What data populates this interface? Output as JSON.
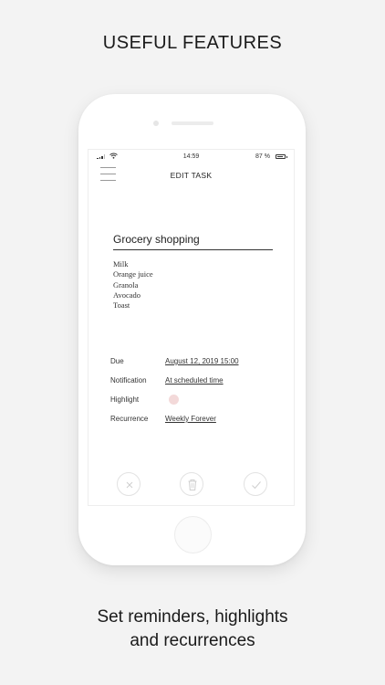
{
  "promo": {
    "headline": "USEFUL FEATURES",
    "caption_line1": "Set reminders, highlights",
    "caption_line2": "and recurrences"
  },
  "status_bar": {
    "time": "14:59",
    "battery": "87 %"
  },
  "nav": {
    "title": "EDIT TASK",
    "menu_icon": "hamburger-menu-icon"
  },
  "task": {
    "title": "Grocery shopping",
    "notes": [
      "Milk",
      "Orange juice",
      "Granola",
      "Avocado",
      "Toast"
    ]
  },
  "details": {
    "due_label": "Due",
    "due_value": "August 12, 2019 15:00",
    "notification_label": "Notification",
    "notification_value": "At scheduled time",
    "highlight_label": "Highlight",
    "highlight_color": "#f3d9d9",
    "recurrence_label": "Recurrence",
    "recurrence_value": "Weekly Forever"
  },
  "actions": {
    "close_icon": "close-icon",
    "delete_icon": "trash-icon",
    "confirm_icon": "checkmark-icon"
  }
}
